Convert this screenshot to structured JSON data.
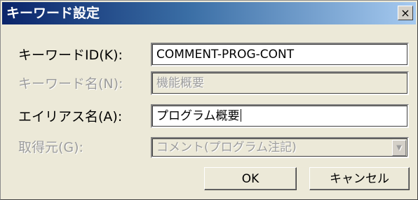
{
  "dialog": {
    "title": "キーワード設定",
    "close_glyph": "×"
  },
  "form": {
    "keyword_id": {
      "label": "キーワードID(K):",
      "value": "COMMENT-PROG-CONT",
      "enabled": true
    },
    "keyword_name": {
      "label": "キーワード名(N):",
      "value": "機能概要",
      "enabled": false
    },
    "alias_name": {
      "label": "エイリアス名(A):",
      "value": "プログラム概要",
      "enabled": true
    },
    "source": {
      "label": "取得元(G):",
      "selected": "コメント(プログラム注記)",
      "enabled": false
    }
  },
  "buttons": {
    "ok": "OK",
    "cancel": "キャンセル"
  },
  "icons": {
    "close": "close-icon",
    "dropdown": "chevron-down-icon"
  },
  "colors": {
    "title_gradient_start": "#0a246a",
    "title_gradient_end": "#a6caf0",
    "dialog_background": "#ece9d8",
    "disabled_text": "#9c9c9c"
  }
}
